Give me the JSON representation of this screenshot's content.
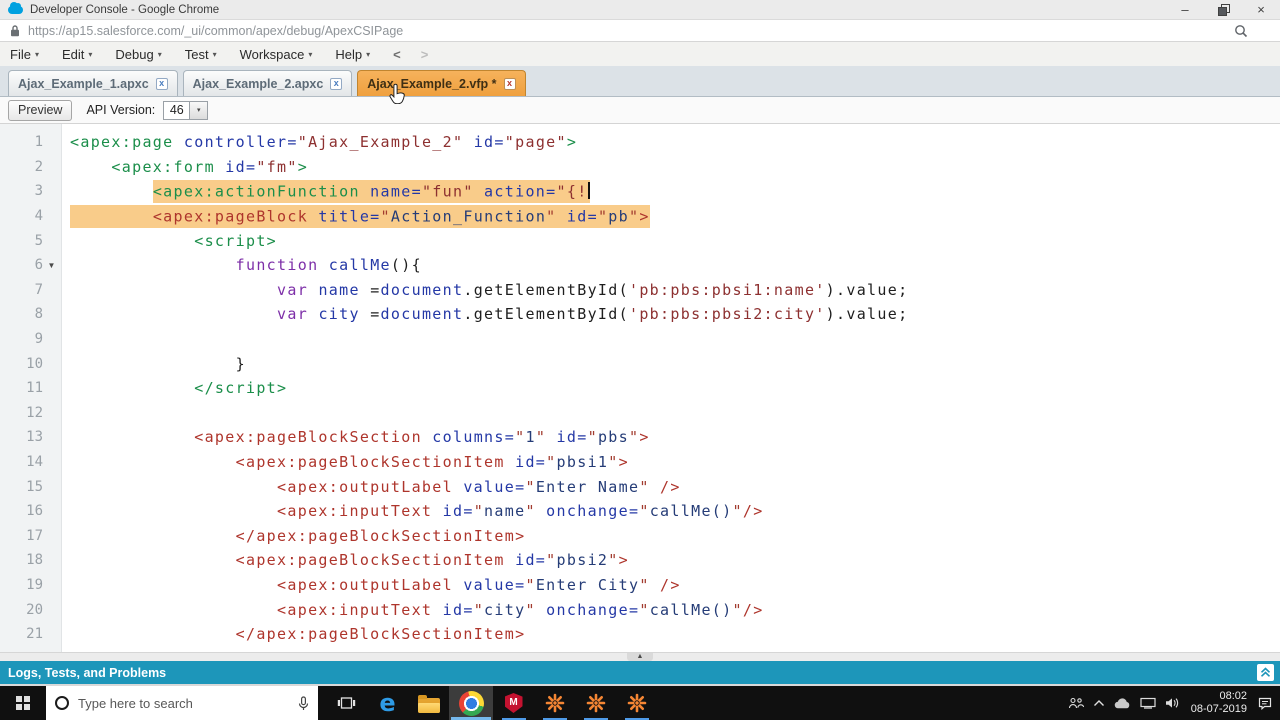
{
  "window": {
    "title": "Developer Console - Google Chrome",
    "url": "https://ap15.salesforce.com/_ui/common/apex/debug/ApexCSIPage"
  },
  "menu": {
    "items": [
      "File",
      "Edit",
      "Debug",
      "Test",
      "Workspace",
      "Help"
    ],
    "back": "<",
    "forward": ">"
  },
  "tabs": [
    {
      "label": "Ajax_Example_1.apxc",
      "active": false
    },
    {
      "label": "Ajax_Example_2.apxc",
      "active": false
    },
    {
      "label": "Ajax_Example_2.vfp *",
      "active": true
    }
  ],
  "toolbar": {
    "preview": "Preview",
    "api_version_label": "API Version:",
    "api_version_value": "46"
  },
  "editor": {
    "lines": [
      {
        "num": 1,
        "tokens": [
          [
            "<apex:page",
            "tg"
          ],
          [
            " controller=",
            "an"
          ],
          [
            "\"Ajax_Example_2\"",
            "vm"
          ],
          [
            " id=",
            "an"
          ],
          [
            "\"page\"",
            "vm"
          ],
          [
            ">",
            "tg"
          ]
        ]
      },
      {
        "num": 2,
        "tokens": [
          [
            "    ",
            "pl"
          ],
          [
            "<apex:form",
            "tg"
          ],
          [
            " id=",
            "an"
          ],
          [
            "\"fm\"",
            "vm"
          ],
          [
            ">",
            "tg"
          ]
        ]
      },
      {
        "num": 3,
        "hl": "content",
        "cursor": true,
        "tokens": [
          [
            "        ",
            "pl"
          ],
          [
            "<apex:actionFunction",
            "tg"
          ],
          [
            " name=",
            "an"
          ],
          [
            "\"fun\"",
            "vm"
          ],
          [
            " action=",
            "an"
          ],
          [
            "\"{!",
            "vm"
          ]
        ]
      },
      {
        "num": 4,
        "hl": "full",
        "tokens": [
          [
            "        ",
            "pl"
          ],
          [
            "<apex:pageBlock",
            "tr"
          ],
          [
            " title=",
            "an"
          ],
          [
            "\"",
            "qr"
          ],
          [
            "Action_Function",
            "vb"
          ],
          [
            "\"",
            "qr"
          ],
          [
            " id=",
            "an"
          ],
          [
            "\"",
            "qr"
          ],
          [
            "pb",
            "vb"
          ],
          [
            "\"",
            "qr"
          ],
          [
            ">",
            "tr"
          ]
        ]
      },
      {
        "num": 5,
        "tokens": [
          [
            "            ",
            "pl"
          ],
          [
            "<script>",
            "tg"
          ]
        ]
      },
      {
        "num": 6,
        "fold": true,
        "tokens": [
          [
            "                ",
            "pl"
          ],
          [
            "function",
            "kw"
          ],
          [
            " ",
            "pl"
          ],
          [
            "callMe",
            "id"
          ],
          [
            "(){",
            "pl"
          ]
        ]
      },
      {
        "num": 7,
        "tokens": [
          [
            "                    ",
            "pl"
          ],
          [
            "var",
            "kw"
          ],
          [
            " ",
            "pl"
          ],
          [
            "name",
            "id"
          ],
          [
            " =",
            "pl"
          ],
          [
            "document",
            "id"
          ],
          [
            ".getElementById(",
            "pl"
          ],
          [
            "'pb:pbs:pbsi1:name'",
            "st"
          ],
          [
            ").value;",
            "pl"
          ]
        ]
      },
      {
        "num": 8,
        "tokens": [
          [
            "                    ",
            "pl"
          ],
          [
            "var",
            "kw"
          ],
          [
            " ",
            "pl"
          ],
          [
            "city",
            "id"
          ],
          [
            " =",
            "pl"
          ],
          [
            "document",
            "id"
          ],
          [
            ".getElementById(",
            "pl"
          ],
          [
            "'pb:pbs:pbsi2:city'",
            "st"
          ],
          [
            ").value;",
            "pl"
          ]
        ]
      },
      {
        "num": 9,
        "tokens": []
      },
      {
        "num": 10,
        "tokens": [
          [
            "                }",
            "pl"
          ]
        ]
      },
      {
        "num": 11,
        "tokens": [
          [
            "            ",
            "pl"
          ],
          [
            "</script>",
            "tg"
          ]
        ]
      },
      {
        "num": 12,
        "tokens": []
      },
      {
        "num": 13,
        "tokens": [
          [
            "            ",
            "pl"
          ],
          [
            "<apex:pageBlockSection",
            "tr"
          ],
          [
            " columns=",
            "an"
          ],
          [
            "\"",
            "qr"
          ],
          [
            "1",
            "vb"
          ],
          [
            "\"",
            "qr"
          ],
          [
            " id=",
            "an"
          ],
          [
            "\"",
            "qr"
          ],
          [
            "pbs",
            "vb"
          ],
          [
            "\"",
            "qr"
          ],
          [
            ">",
            "tr"
          ]
        ]
      },
      {
        "num": 14,
        "tokens": [
          [
            "                ",
            "pl"
          ],
          [
            "<apex:pageBlockSectionItem",
            "tr"
          ],
          [
            " id=",
            "an"
          ],
          [
            "\"",
            "qr"
          ],
          [
            "pbsi1",
            "vb"
          ],
          [
            "\"",
            "qr"
          ],
          [
            ">",
            "tr"
          ]
        ]
      },
      {
        "num": 15,
        "tokens": [
          [
            "                    ",
            "pl"
          ],
          [
            "<apex:outputLabel",
            "tr"
          ],
          [
            " value=",
            "an"
          ],
          [
            "\"",
            "qr"
          ],
          [
            "Enter Name",
            "vb"
          ],
          [
            "\"",
            "qr"
          ],
          [
            " />",
            "tr"
          ]
        ]
      },
      {
        "num": 16,
        "tokens": [
          [
            "                    ",
            "pl"
          ],
          [
            "<apex:inputText",
            "tr"
          ],
          [
            " id=",
            "an"
          ],
          [
            "\"",
            "qr"
          ],
          [
            "name",
            "vb"
          ],
          [
            "\"",
            "qr"
          ],
          [
            " onchange=",
            "an"
          ],
          [
            "\"",
            "qr"
          ],
          [
            "callMe()",
            "vb"
          ],
          [
            "\"",
            "qr"
          ],
          [
            "/>",
            "tr"
          ]
        ]
      },
      {
        "num": 17,
        "tokens": [
          [
            "                ",
            "pl"
          ],
          [
            "</apex:pageBlockSectionItem>",
            "tr"
          ]
        ]
      },
      {
        "num": 18,
        "tokens": [
          [
            "                ",
            "pl"
          ],
          [
            "<apex:pageBlockSectionItem",
            "tr"
          ],
          [
            " id=",
            "an"
          ],
          [
            "\"",
            "qr"
          ],
          [
            "pbsi2",
            "vb"
          ],
          [
            "\"",
            "qr"
          ],
          [
            ">",
            "tr"
          ]
        ]
      },
      {
        "num": 19,
        "tokens": [
          [
            "                    ",
            "pl"
          ],
          [
            "<apex:outputLabel",
            "tr"
          ],
          [
            " value=",
            "an"
          ],
          [
            "\"",
            "qr"
          ],
          [
            "Enter City",
            "vb"
          ],
          [
            "\"",
            "qr"
          ],
          [
            " />",
            "tr"
          ]
        ]
      },
      {
        "num": 20,
        "tokens": [
          [
            "                    ",
            "pl"
          ],
          [
            "<apex:inputText",
            "tr"
          ],
          [
            " id=",
            "an"
          ],
          [
            "\"",
            "qr"
          ],
          [
            "city",
            "vb"
          ],
          [
            "\"",
            "qr"
          ],
          [
            " onchange=",
            "an"
          ],
          [
            "\"",
            "qr"
          ],
          [
            "callMe()",
            "vb"
          ],
          [
            "\"",
            "qr"
          ],
          [
            "/>",
            "tr"
          ]
        ]
      },
      {
        "num": 21,
        "tokens": [
          [
            "                ",
            "pl"
          ],
          [
            "</apex:pageBlockSectionItem>",
            "tr"
          ]
        ]
      }
    ]
  },
  "bottom_panel": {
    "label": "Logs, Tests, and Problems"
  },
  "taskbar": {
    "search_placeholder": "Type here to search",
    "time": "08:02",
    "date": "08-07-2019"
  },
  "colors": {
    "active_tab": "#f2a84c",
    "selection_highlight": "#f9cc8a",
    "logs_bar": "#1d96ba",
    "taskbar": "#101010",
    "tag_green": "#1b8e4a",
    "tag_red": "#ae352c",
    "attr_navy": "#2438a6",
    "string_maroon": "#8d3030"
  },
  "icons": {
    "salesforce_cloud": "cloud-shape",
    "lock": "padlock",
    "page_zoom": "magnifier",
    "minimize": "–",
    "restore": "overlapping-squares",
    "close": "×",
    "menu_caret": "▾",
    "tab_close": "x",
    "select_caret": "▾",
    "fold_arrow": "▼",
    "splitter_handle": "▲",
    "expand_panel": "double-chevron-up",
    "edge_letter": "e",
    "mcafee_letter": "M",
    "hand_cursor": "pointer-hand"
  }
}
